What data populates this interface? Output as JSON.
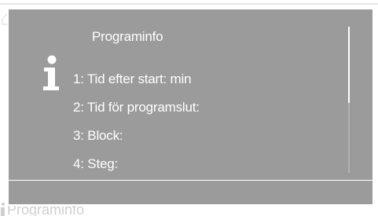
{
  "background": {
    "title": "Programinfo"
  },
  "dialog": {
    "title": "Programinfo",
    "icon": "info-icon",
    "items": [
      {
        "label": "1:  Tid efter start:  min"
      },
      {
        "label": "2:  Tid för programslut:"
      },
      {
        "label": "3:  Block:"
      },
      {
        "label": "4:  Steg:"
      }
    ],
    "scroll": {
      "visible_fraction": 0.52,
      "position": 0
    }
  },
  "colors": {
    "dialog_background": "#9b9b9b",
    "text": "#ffffff",
    "border": "#ffffff"
  }
}
